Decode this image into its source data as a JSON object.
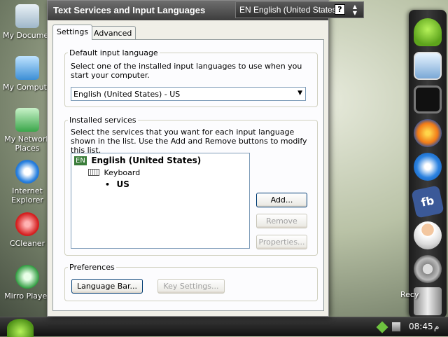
{
  "desktop": {
    "icons": [
      {
        "label": "My Documents",
        "icon": "folder-icon"
      },
      {
        "label": "My Computer",
        "icon": "computer-icon"
      },
      {
        "label": "My Network Places",
        "icon": "network-icon"
      },
      {
        "label": "Internet Explorer",
        "icon": "ie-icon"
      },
      {
        "label": "CCleaner",
        "icon": "ccleaner-icon"
      },
      {
        "label": "Mirro Player",
        "icon": "player-icon"
      }
    ],
    "recycle_label": "Recy"
  },
  "dialog": {
    "title": "Text Services and Input Languages",
    "tabs": [
      "Settings",
      "Advanced"
    ],
    "default_input": {
      "legend": "Default input language",
      "description": "Select one of the installed input languages to use when you start your computer.",
      "selected": "English (United States) - US"
    },
    "installed_services": {
      "legend": "Installed services",
      "description": "Select the services that you want for each input language shown in the list. Use the Add and Remove buttons to modify this list.",
      "tree": {
        "lang_badge": "EN",
        "language": "English (United States)",
        "category": "Keyboard",
        "layout": "US"
      },
      "buttons": {
        "add": "Add...",
        "remove": "Remove",
        "properties": "Properties..."
      }
    },
    "preferences": {
      "legend": "Preferences",
      "language_bar": "Language Bar...",
      "key_settings": "Key Settings..."
    }
  },
  "language_bar": {
    "label": "EN English (United States)",
    "help": "?"
  },
  "taskbar": {
    "clock": "08:45",
    "ampm": "م"
  },
  "colors": {
    "title_bg": "#3d3d3d",
    "dialog_bg": "#f0efe7",
    "button_border": "#003c74"
  }
}
